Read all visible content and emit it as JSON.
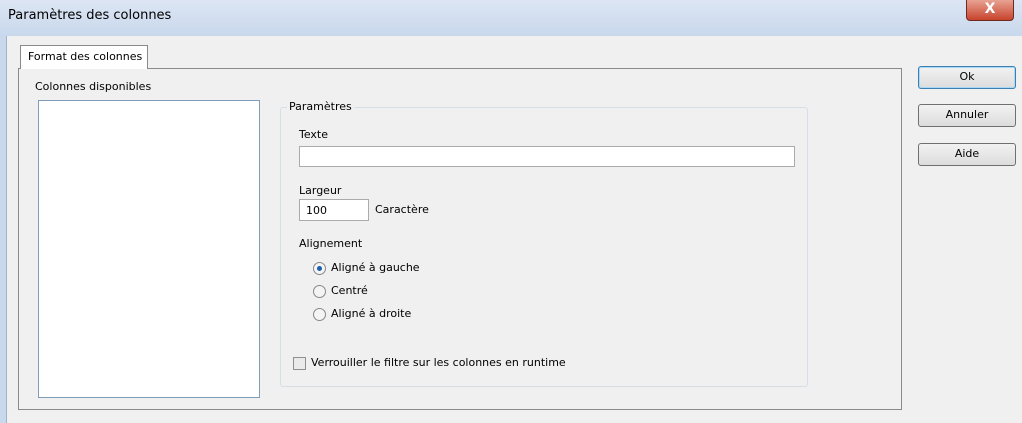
{
  "window": {
    "title": "Paramètres des colonnes",
    "close_symbol": "X"
  },
  "tab": {
    "label": "Format des colonnes"
  },
  "available_columns": {
    "label": "Colonnes disponibles",
    "items": []
  },
  "parameters": {
    "group_title": "Paramètres",
    "text_label": "Texte",
    "text_value": "",
    "width_label": "Largeur",
    "width_value": "100",
    "width_unit": "Caractère",
    "alignment_label": "Alignement",
    "alignment_options": [
      "Aligné à gauche",
      "Centré",
      "Aligné à droite"
    ],
    "alignment_selected": "Aligné à gauche",
    "lock_filter_label": "Verrouiller le filtre sur les colonnes en runtime",
    "lock_filter_checked": false
  },
  "buttons": {
    "ok": "Ok",
    "cancel": "Annuler",
    "help": "Aide"
  }
}
